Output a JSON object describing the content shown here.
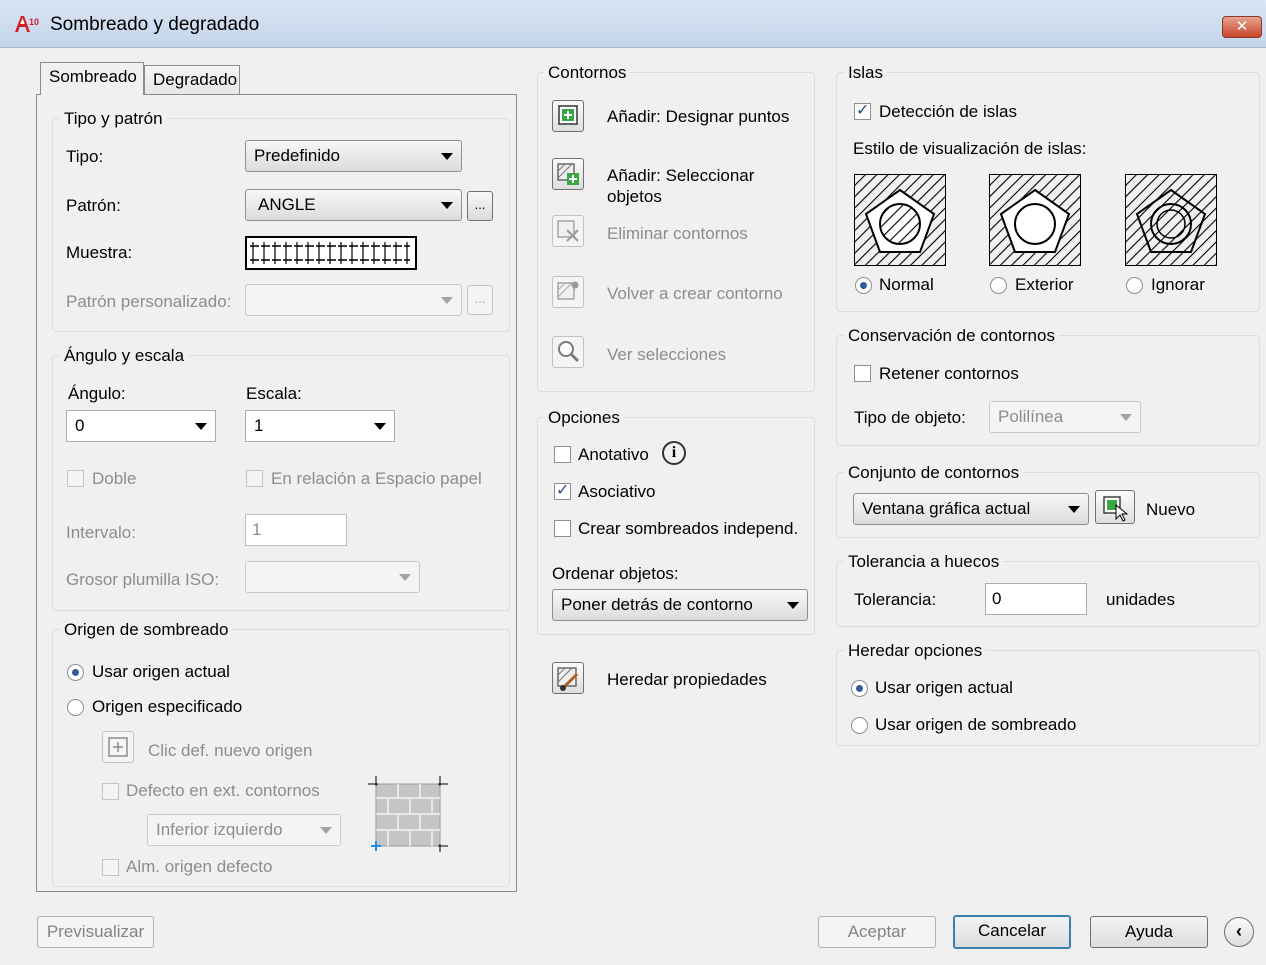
{
  "window": {
    "title": "Sombreado y degradado",
    "close_label": "✕",
    "icon_text": "A10"
  },
  "tabs": [
    {
      "label": "Sombreado"
    },
    {
      "label": "Degradado"
    }
  ],
  "tipo_patron": {
    "title": "Tipo y patrón",
    "tipo_label": "Tipo:",
    "tipo_value": "Predefinido",
    "patron_label": "Patrón:",
    "patron_value": "ANGLE",
    "muestra_label": "Muestra:",
    "personalizado_label": "Patrón personalizado:",
    "personalizado_value": "",
    "browse_label": "..."
  },
  "angulo_escala": {
    "title": "Ángulo y escala",
    "angulo_label": "Ángulo:",
    "angulo_value": "0",
    "escala_label": "Escala:",
    "escala_value": "1",
    "doble_label": "Doble",
    "doble_checked": false,
    "espacio_papel_label": "En relación a Espacio papel",
    "espacio_papel_checked": false,
    "intervalo_label": "Intervalo:",
    "intervalo_value": "1",
    "grosor_label": "Grosor plumilla ISO:",
    "grosor_value": ""
  },
  "origen": {
    "title": "Origen de sombreado",
    "usar_actual_label": "Usar origen actual",
    "usar_actual_selected": true,
    "especificado_label": "Origen especificado",
    "especificado_selected": false,
    "clic_label": "Clic def. nuevo origen",
    "defecto_label": "Defecto en ext. contornos",
    "defecto_checked": false,
    "posicion_value": "Inferior izquierdo",
    "alm_label": "Alm. origen defecto",
    "alm_checked": false
  },
  "contornos": {
    "title": "Contornos",
    "designar_label": "Añadir: Designar puntos",
    "seleccionar_label": "Añadir: Seleccionar objetos",
    "eliminar_label": "Eliminar contornos",
    "volver_label": "Volver a crear contorno",
    "ver_label": "Ver selecciones"
  },
  "opciones": {
    "title": "Opciones",
    "anotativo_label": "Anotativo",
    "anotativo_checked": false,
    "info_icon": "i",
    "asociativo_label": "Asociativo",
    "asociativo_checked": true,
    "independ_label": "Crear sombreados independ.",
    "independ_checked": false,
    "ordenar_label": "Ordenar objetos:",
    "ordenar_value": "Poner detrás de contorno"
  },
  "heredar_propiedades_label": "Heredar propiedades",
  "islas": {
    "title": "Islas",
    "deteccion_label": "Detección de islas",
    "deteccion_checked": true,
    "estilo_label": "Estilo de visualización de islas:",
    "normal_label": "Normal",
    "exterior_label": "Exterior",
    "ignorar_label": "Ignorar",
    "selected": "Normal"
  },
  "conservacion": {
    "title": "Conservación de contornos",
    "retener_label": "Retener contornos",
    "retener_checked": false,
    "tipo_label": "Tipo de objeto:",
    "tipo_value": "Polilínea"
  },
  "conjunto": {
    "title": "Conjunto de contornos",
    "value": "Ventana gráfica actual",
    "nuevo_label": "Nuevo"
  },
  "tolerancia": {
    "title": "Tolerancia a huecos",
    "label": "Tolerancia:",
    "value": "0",
    "units": "unidades"
  },
  "heredar_opciones": {
    "title": "Heredar opciones",
    "usar_actual_label": "Usar origen actual",
    "usar_actual_selected": true,
    "usar_sombreado_label": "Usar origen de sombreado",
    "usar_sombreado_selected": false
  },
  "footer": {
    "previsualizar_label": "Previsualizar",
    "aceptar_label": "Aceptar",
    "cancelar_label": "Cancelar",
    "ayuda_label": "Ayuda",
    "collapse_label": "‹"
  }
}
